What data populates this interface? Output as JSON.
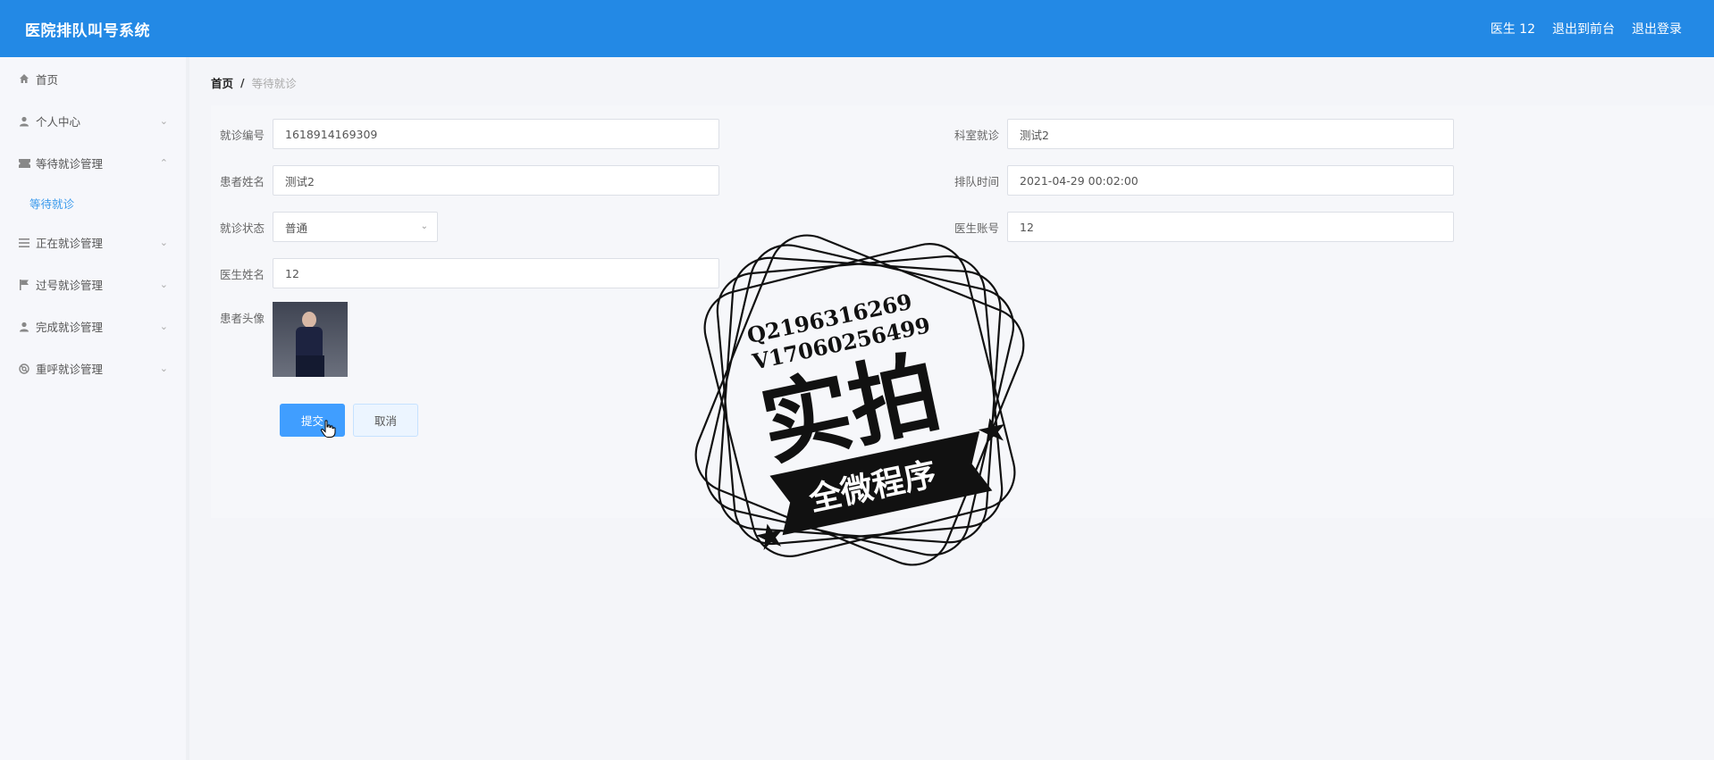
{
  "app": {
    "title": "医院排队叫号系统"
  },
  "topnav": {
    "user": "医生 12",
    "to_front": "退出到前台",
    "logout": "退出登录"
  },
  "sidebar": {
    "items": [
      {
        "label": "首页",
        "icon": "home-icon",
        "expandable": false
      },
      {
        "label": "个人中心",
        "icon": "user-icon",
        "expandable": true
      },
      {
        "label": "等待就诊管理",
        "icon": "ticket-icon",
        "expandable": true,
        "expanded": true,
        "children": [
          {
            "label": "等待就诊",
            "active": true
          }
        ]
      },
      {
        "label": "正在就诊管理",
        "icon": "list-icon",
        "expandable": true
      },
      {
        "label": "过号就诊管理",
        "icon": "flag-icon",
        "expandable": true
      },
      {
        "label": "完成就诊管理",
        "icon": "user-icon",
        "expandable": true
      },
      {
        "label": "重呼就诊管理",
        "icon": "life-ring-icon",
        "expandable": true
      }
    ]
  },
  "breadcrumb": {
    "home": "首页",
    "separator": "/",
    "current": "等待就诊"
  },
  "form": {
    "visit_no": {
      "label": "就诊编号",
      "value": "1618914169309"
    },
    "department": {
      "label": "科室就诊",
      "value": "测试2"
    },
    "patient_name": {
      "label": "患者姓名",
      "value": "测试2"
    },
    "queue_time": {
      "label": "排队时间",
      "value": "2021-04-29 00:02:00"
    },
    "status": {
      "label": "就诊状态",
      "value": "普通"
    },
    "doctor_account": {
      "label": "医生账号",
      "value": "12"
    },
    "doctor_name": {
      "label": "医生姓名",
      "value": "12"
    },
    "patient_avatar": {
      "label": "患者头像"
    },
    "submit": "提交",
    "cancel": "取消"
  },
  "watermark": {
    "qq": "Q2196316269",
    "wechat": "V17060256499",
    "main": "实拍",
    "banner": "全微程序"
  },
  "colors": {
    "primary": "#2389e5",
    "button": "#409eff",
    "active_link": "#3a9aec"
  }
}
